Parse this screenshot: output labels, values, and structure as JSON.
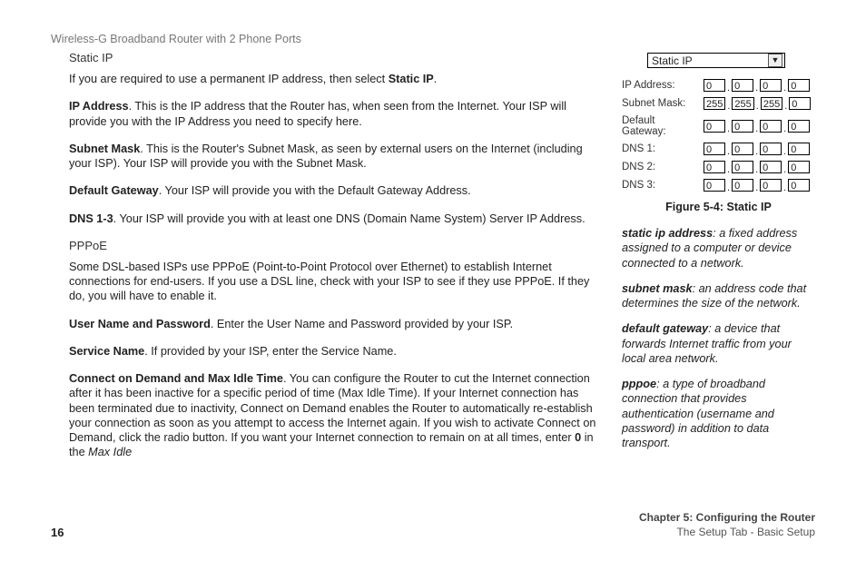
{
  "running_head": "Wireless-G Broadband Router with 2 Phone Ports",
  "main": {
    "static_ip_heading": "Static IP",
    "static_ip_intro_a": "If you are required to use a permanent IP address, then select ",
    "static_ip_intro_b": "Static IP",
    "static_ip_intro_c": ".",
    "ip_address_term": "IP Address",
    "ip_address_body": ". This is the IP address that the Router has, when seen from the Internet. Your ISP will provide you with the IP Address you need to specify here.",
    "subnet_mask_term": "Subnet Mask",
    "subnet_mask_body": ". This is the Router's Subnet Mask, as seen by external users on the Internet (including your ISP). Your ISP will provide you with the Subnet Mask.",
    "default_gateway_term": "Default Gateway",
    "default_gateway_body": ". Your ISP will provide you with the Default Gateway Address.",
    "dns_term": "DNS 1-3",
    "dns_body": ". Your ISP will provide you with at least one DNS (Domain Name System) Server IP Address.",
    "pppoe_heading": "PPPoE",
    "pppoe_intro": "Some DSL-based ISPs use PPPoE (Point-to-Point Protocol over Ethernet) to establish Internet connections for end-users. If you use a DSL line, check with your ISP to see if they use PPPoE. If they do, you will have to enable it.",
    "user_pass_term": "User Name and Password",
    "user_pass_body": ". Enter the User Name and Password provided by your ISP.",
    "service_name_term": "Service Name",
    "service_name_body": ". If provided by your ISP, enter the Service Name.",
    "cod_term": "Connect on Demand and Max Idle Time",
    "cod_body_a": ". You can configure the Router to cut the Internet connection after it has been inactive for a specific period of time (Max Idle Time). If your Internet connection has been terminated due to inactivity, Connect on Demand enables the Router to automatically re-establish your connection as soon as you attempt to access the Internet again. If you wish to activate Connect on Demand, click the radio button. If you want your Internet connection to remain on at all times, enter ",
    "cod_zero": "0",
    "cod_body_b": " in the ",
    "cod_tail_em": "Max Idle"
  },
  "figure": {
    "dropdown_value": "Static IP",
    "rows": [
      {
        "label": "IP Address:",
        "octets": [
          "0",
          "0",
          "0",
          "0"
        ]
      },
      {
        "label": "Subnet Mask:",
        "octets": [
          "255",
          "255",
          "255",
          "0"
        ]
      },
      {
        "label": "Default Gateway:",
        "octets": [
          "0",
          "0",
          "0",
          "0"
        ]
      },
      {
        "label": "DNS 1:",
        "octets": [
          "0",
          "0",
          "0",
          "0"
        ]
      },
      {
        "label": "DNS 2:",
        "octets": [
          "0",
          "0",
          "0",
          "0"
        ]
      },
      {
        "label": "DNS 3:",
        "octets": [
          "0",
          "0",
          "0",
          "0"
        ]
      }
    ],
    "caption": "Figure 5-4: Static IP"
  },
  "glossary": {
    "t1_term": "static ip address",
    "t1_body": ": a fixed address assigned to a computer or device connected to a network.",
    "t2_term": "subnet mask",
    "t2_body": ": an address code that determines the size of the network.",
    "t3_term": "default gateway",
    "t3_body": ": a device that forwards Internet traffic from your local area network.",
    "t4_term": "pppoe",
    "t4_body": ": a type of broadband connection that provides authentication (username and password) in addition to data transport."
  },
  "footer": {
    "page_number": "16",
    "chapter_line1": "Chapter 5: Configuring the Router",
    "chapter_line2": "The Setup Tab - Basic Setup"
  }
}
